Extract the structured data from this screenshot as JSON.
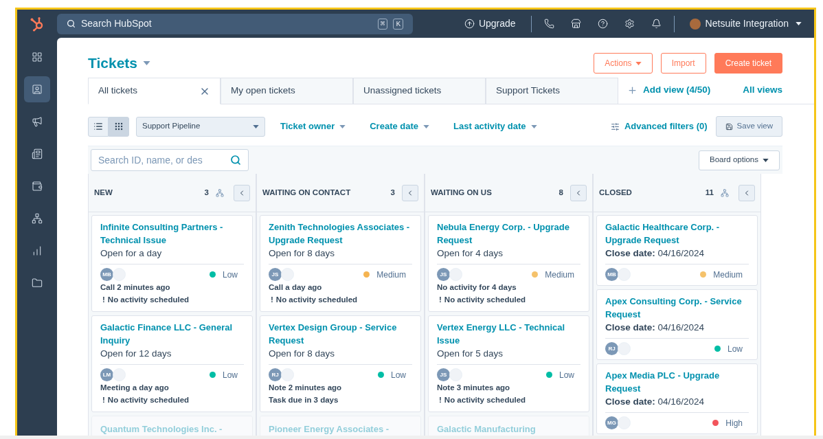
{
  "top_bar": {
    "search": {
      "placeholder": "Search HubSpot",
      "shortcut": [
        "⌘",
        "K"
      ]
    },
    "upgrade": "Upgrade",
    "account": "Netsuite Integration"
  },
  "sidebar": {
    "items": [
      {
        "selected": false
      },
      {
        "selected": true
      },
      {
        "selected": false
      },
      {
        "selected": false
      },
      {
        "selected": false
      },
      {
        "selected": false
      },
      {
        "selected": false
      },
      {
        "selected": false
      }
    ]
  },
  "page": {
    "title": "Tickets",
    "buttons": [
      {
        "label": "Actions",
        "kind": "menu"
      },
      {
        "label": "Import",
        "kind": "outline"
      },
      {
        "label": "Create ticket",
        "kind": "primary"
      }
    ]
  },
  "tabs": [
    {
      "label": "All tickets",
      "selected": true,
      "closable": true
    },
    {
      "label": "My open tickets",
      "selected": false,
      "closable": false
    },
    {
      "label": "Unassigned tickets",
      "selected": false,
      "closable": false
    },
    {
      "label": "Support Tickets",
      "selected": false,
      "closable": false
    }
  ],
  "add_view": "Add view (4/50)",
  "all_views": "All views",
  "filters": {
    "view_modes": [
      {
        "selected": false
      },
      {
        "selected": true
      }
    ],
    "pipeline": "Support Pipeline",
    "dropdowns": [
      "Ticket owner",
      "Create date",
      "Last activity date"
    ],
    "advanced": "Advanced filters (0)",
    "save_view": "Save view"
  },
  "board": {
    "search": {
      "placeholder": "Search ID, name, or des"
    },
    "board_options": "Board options",
    "columns": [
      {
        "name": "NEW",
        "count": "3",
        "tree": true,
        "cards": [
          {
            "kind": "full",
            "title": "Infinite Consulting Partners - Technical Issue",
            "subtitle": "Open for a day",
            "owner": "MB",
            "priority": {
              "label": "Low",
              "color": "#00bda5"
            },
            "lines": [
              {
                "text": "Call 2 minutes ago"
              },
              {
                "marker": "!",
                "text": "No activity scheduled"
              }
            ]
          },
          {
            "kind": "full",
            "title": "Galactic Finance LLC - General Inquiry",
            "subtitle": "Open for 12 days",
            "owner": "LM",
            "priority": {
              "label": "Low",
              "color": "#00bda5"
            },
            "lines": [
              {
                "text": "Meeting a day ago"
              },
              {
                "marker": "!",
                "text": "No activity scheduled"
              }
            ]
          },
          {
            "kind": "partial",
            "title": "Quantum Technologies Inc. -"
          }
        ]
      },
      {
        "name": "WAITING ON CONTACT",
        "count": "3",
        "tree": false,
        "cards": [
          {
            "kind": "full",
            "title": "Zenith Technologies Associates - Upgrade Request",
            "subtitle": "Open for 8 days",
            "owner": "JS",
            "priority": {
              "label": "Medium",
              "color": "#f5b451"
            },
            "lines": [
              {
                "text": "Call a day ago"
              },
              {
                "marker": "!",
                "text": "No activity scheduled"
              }
            ]
          },
          {
            "kind": "full",
            "title": "Vertex Design Group - Service Request",
            "subtitle": "Open for 8 days",
            "owner": "RJ",
            "priority": {
              "label": "Low",
              "color": "#00bda5"
            },
            "lines": [
              {
                "text": "Note 2 minutes ago"
              },
              {
                "text": "Task due in 3 days"
              }
            ]
          },
          {
            "kind": "partial",
            "title": "Pioneer Energy Associates -"
          }
        ]
      },
      {
        "name": "WAITING ON US",
        "count": "8",
        "tree": false,
        "cards": [
          {
            "kind": "full",
            "title": "Nebula Energy Corp. - Upgrade Request",
            "subtitle": "Open for 4 days",
            "owner": "JS",
            "priority": {
              "label": "Medium",
              "color": "#f5c26b"
            },
            "lines": [
              {
                "text": "No activity for 4 days"
              },
              {
                "marker": "!",
                "text": "No activity scheduled"
              }
            ]
          },
          {
            "kind": "full",
            "title": "Vertex Energy LLC - Technical Issue",
            "subtitle": "Open for 5 days",
            "owner": "JS",
            "priority": {
              "label": "Low",
              "color": "#00bda5"
            },
            "lines": [
              {
                "text": "Note 3 minutes ago"
              },
              {
                "marker": "!",
                "text": "No activity scheduled"
              }
            ]
          },
          {
            "kind": "partial",
            "title": "Galactic Manufacturing"
          }
        ]
      },
      {
        "name": "CLOSED",
        "count": "11",
        "tree": true,
        "cards": [
          {
            "kind": "full",
            "title": "Galactic Healthcare Corp. - Upgrade Request",
            "subtitle": "**Close date:** 04/16/2024",
            "owner": "MB",
            "priority": {
              "label": "Medium",
              "color": "#f5c26b"
            }
          },
          {
            "kind": "full",
            "title": "Apex Consulting Corp. - Service Request",
            "subtitle": "**Close date:** 04/16/2024",
            "owner": "RJ",
            "priority": {
              "label": "Low",
              "color": "#00bda5"
            }
          },
          {
            "kind": "full",
            "title": "Apex Media PLC - Upgrade Request",
            "subtitle": "**Close date:** 04/16/2024",
            "owner": "MG",
            "priority": {
              "label": "High",
              "color": "#f2545b"
            }
          }
        ]
      }
    ]
  }
}
